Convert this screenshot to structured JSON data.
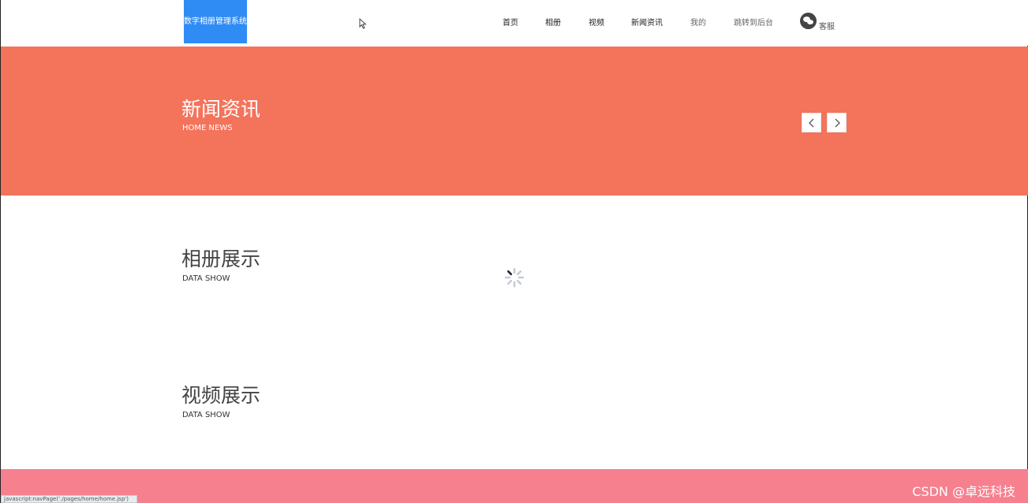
{
  "header": {
    "logo_text": "数字相册管理系统的",
    "nav": [
      {
        "label": "首页",
        "style": "normal"
      },
      {
        "label": "相册",
        "style": "normal"
      },
      {
        "label": "视频",
        "style": "normal"
      },
      {
        "label": "新闻资讯",
        "style": "normal"
      },
      {
        "label": "我的",
        "style": "dim"
      },
      {
        "label": "跳转到后台",
        "style": "dim"
      }
    ],
    "customer_service": {
      "icon": "wechat-icon",
      "label": "客服"
    }
  },
  "banner": {
    "title": "新闻资讯",
    "subtitle": "HOME NEWS",
    "background": "#f4735b",
    "prev_icon": "chevron-left-icon",
    "next_icon": "chevron-right-icon"
  },
  "sections": [
    {
      "title": "相册展示",
      "subtitle": "DATA SHOW"
    },
    {
      "title": "视频展示",
      "subtitle": "DATA SHOW"
    }
  ],
  "loading": {
    "icon": "loading-spinner-icon"
  },
  "footer": {
    "background": "#f6808e"
  },
  "status_bar": {
    "text": "javascript:navPage('./pages/home/home.jsp')"
  },
  "watermark": {
    "text": "CSDN @卓远科技"
  },
  "colors": {
    "logo_bg": "#2f8cf5",
    "banner": "#f4735b",
    "footer": "#f6808e"
  }
}
